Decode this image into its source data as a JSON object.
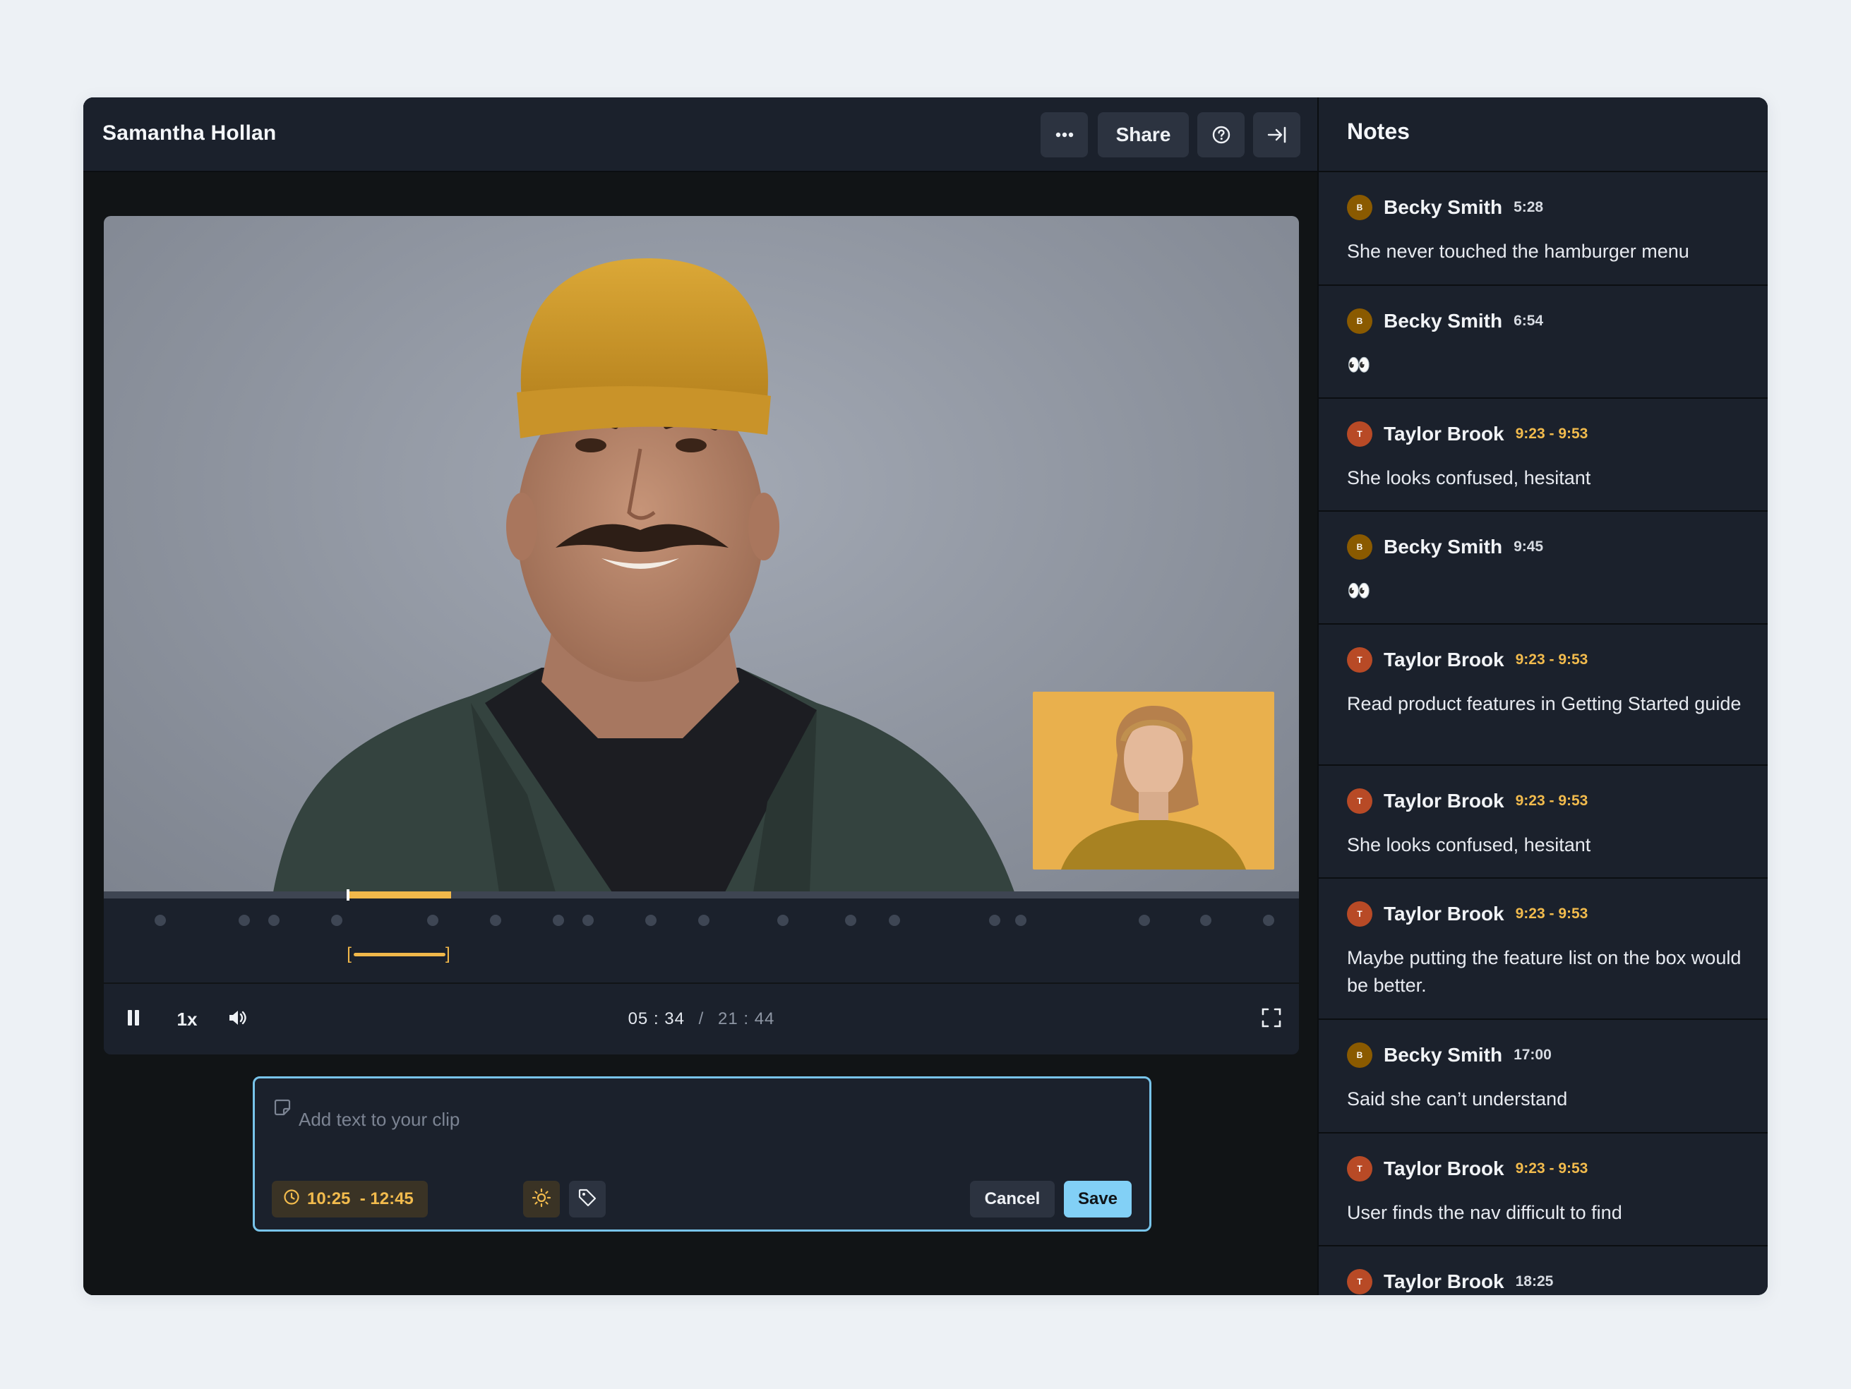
{
  "header": {
    "title": "Samantha Hollan",
    "more_icon": "more-horizontal-icon",
    "share_label": "Share",
    "help_icon": "help-circle-icon",
    "collapse_icon": "collapse-panel-icon"
  },
  "player": {
    "progress_fraction": 0.2045,
    "clip_start_fraction": 0.2045,
    "clip_end_fraction": 0.2906,
    "speed_label": "1x",
    "current_time": "05 : 34",
    "separator": "/",
    "total_time": "21 : 44",
    "clip_range_open": "[",
    "clip_range_close": "]",
    "pause_icon": "pause-icon",
    "volume_icon": "volume-icon",
    "fullscreen_icon": "fullscreen-icon"
  },
  "clip_editor": {
    "placeholder": "Add text to your clip",
    "time_range": "10:25  - 12:45",
    "clock_icon": "clock-icon",
    "highlight_icon": "sun-icon",
    "tag_icon": "tag-icon",
    "cancel_label": "Cancel",
    "save_label": "Save"
  },
  "notes": {
    "title": "Notes",
    "items": [
      {
        "initial": "B",
        "author": "Becky Smith",
        "time": "5:28",
        "text": "She never touched the hamburger menu",
        "color": "#8a5a00"
      },
      {
        "initial": "B",
        "author": "Becky Smith",
        "time": "6:54",
        "text": "👀",
        "color": "#8a5a00"
      },
      {
        "initial": "T",
        "author": "Taylor Brook",
        "time": "9:23 - 9:53",
        "text": "She looks confused, hesitant",
        "color": "#b84a26"
      },
      {
        "initial": "B",
        "author": "Becky Smith",
        "time": "9:45",
        "text": "👀",
        "color": "#8a5a00"
      },
      {
        "initial": "T",
        "author": "Taylor Brook",
        "time": "9:23 - 9:53",
        "text": "Read product features in Getting Started guide",
        "color": "#b84a26"
      },
      {
        "initial": "T",
        "author": "Taylor Brook",
        "time": "9:23 - 9:53",
        "text": "She looks confused, hesitant",
        "color": "#b84a26"
      },
      {
        "initial": "T",
        "author": "Taylor Brook",
        "time": "9:23 - 9:53",
        "text": "Maybe putting the feature list on the box would be better.",
        "color": "#b84a26"
      },
      {
        "initial": "B",
        "author": "Becky Smith",
        "time": "17:00",
        "text": "Said she can’t understand",
        "color": "#8a5a00"
      },
      {
        "initial": "T",
        "author": "Taylor Brook",
        "time": "9:23 - 9:53",
        "text": "User finds the nav difficult to find",
        "color": "#b84a26"
      },
      {
        "initial": "T",
        "author": "Taylor Brook",
        "time": "18:25",
        "text": "",
        "color": "#b84a26"
      }
    ]
  },
  "colors": {
    "accent_yellow": "#f1b84a",
    "accent_blue": "#82d0f6",
    "panel": "#1b212c",
    "background": "#111416"
  }
}
